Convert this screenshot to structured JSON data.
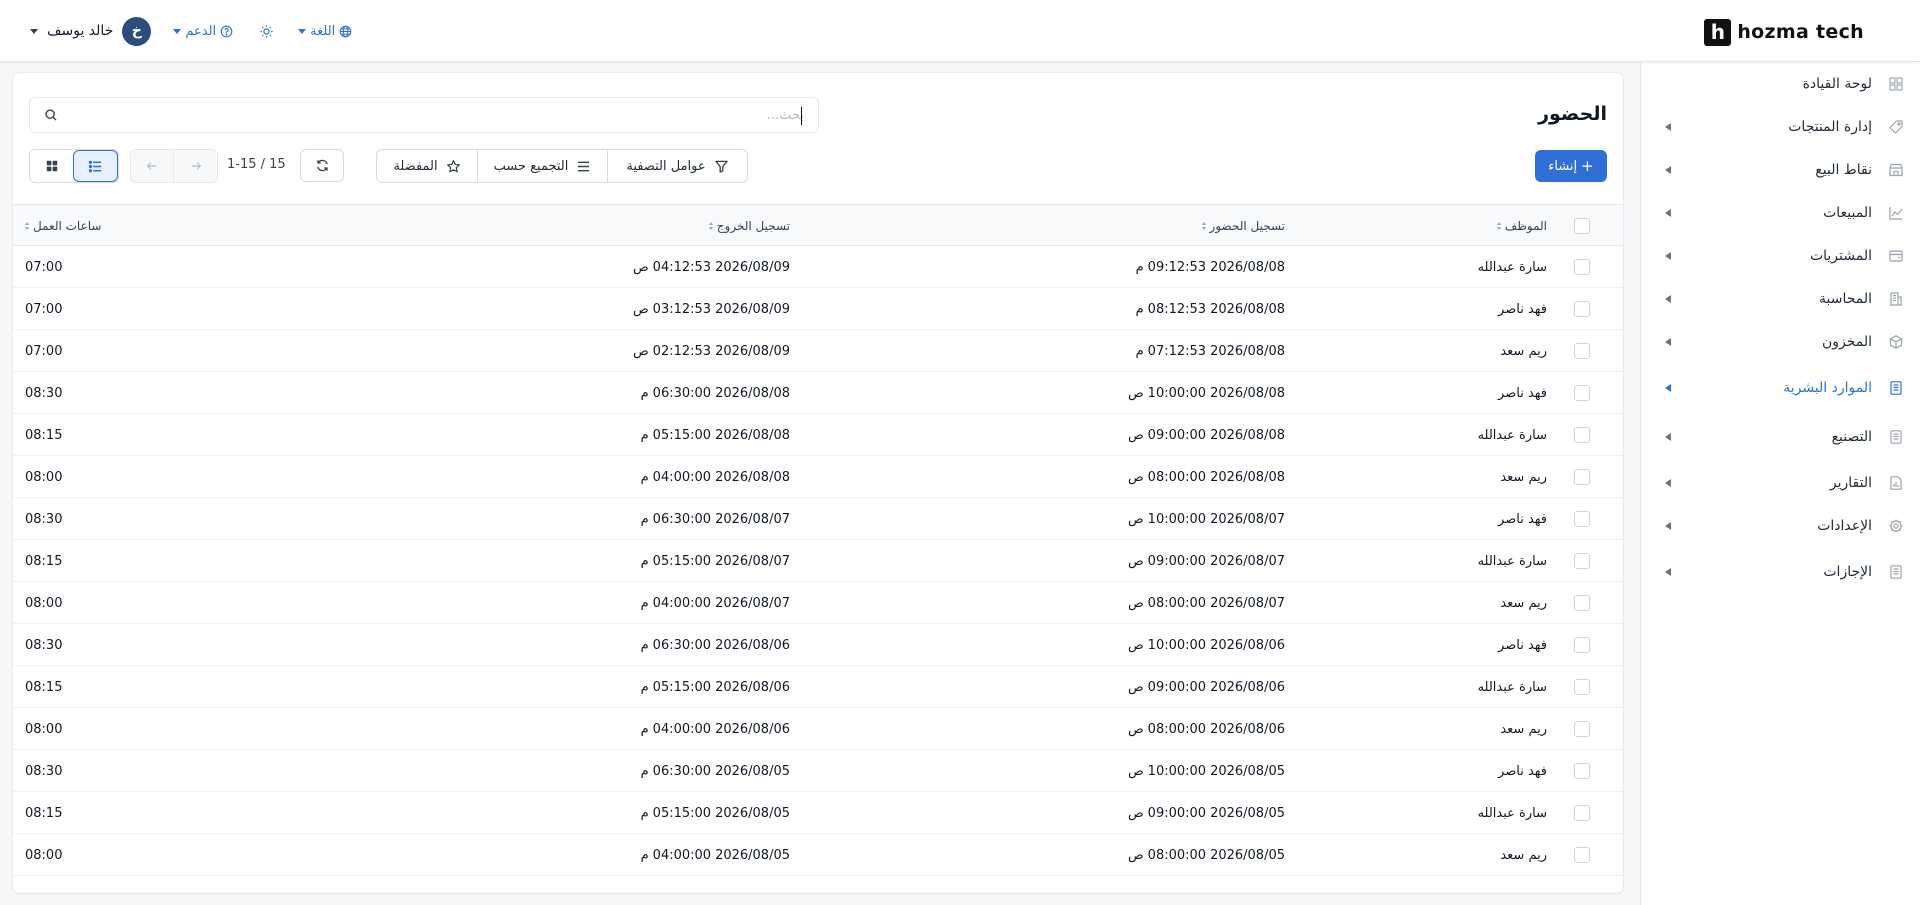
{
  "brand": {
    "logo_letter": "h",
    "name": "hozma tech"
  },
  "topbar": {
    "user_name": "خالد يوسف",
    "user_initial": "خ",
    "support_label": "الدعم",
    "language_label": "اللغة"
  },
  "sidebar": {
    "items": [
      {
        "label": "لوحة القيادة",
        "icon": "dashboard-icon",
        "has_arrow": false
      },
      {
        "label": "إدارة المنتجات",
        "icon": "tag-icon",
        "has_arrow": true
      },
      {
        "label": "نقاط البيع",
        "icon": "store-icon",
        "has_arrow": true
      },
      {
        "label": "المبيعات",
        "icon": "chart-line-icon",
        "has_arrow": true
      },
      {
        "label": "المشتريات",
        "icon": "wallet-icon",
        "has_arrow": true
      },
      {
        "label": "المحاسبة",
        "icon": "building-icon",
        "has_arrow": true
      },
      {
        "label": "المخزون",
        "icon": "box-icon",
        "has_arrow": true
      },
      {
        "label": "الموارد البشرية",
        "icon": "document-icon",
        "has_arrow": true,
        "active": true
      },
      {
        "label": "التصنيع",
        "icon": "document-icon",
        "has_arrow": true
      },
      {
        "label": "التقارير",
        "icon": "report-icon",
        "has_arrow": true
      },
      {
        "label": "الإعدادات",
        "icon": "gear-icon",
        "has_arrow": true
      },
      {
        "label": "الإجازات",
        "icon": "document-icon",
        "has_arrow": true
      }
    ]
  },
  "page": {
    "title": "الحضور",
    "search_placeholder": "بحث...",
    "create_label": "إنشاء",
    "filters_label": "عوامل التصفية",
    "group_by_label": "التجميع حسب",
    "favorites_label": "المفضلة",
    "pager_text": "1-15 / 15"
  },
  "table": {
    "columns": [
      "الموظف",
      "تسجيل الحضور",
      "تسجيل الخروج",
      "ساعات العمل"
    ],
    "rows": [
      {
        "employee": "سارة عبدالله",
        "check_in_date": "2026/08/08",
        "check_in_time": "09:12:53",
        "check_in_ampm": "م",
        "check_out_date": "2026/08/09",
        "check_out_time": "04:12:53",
        "check_out_ampm": "ص",
        "hours": "07:00"
      },
      {
        "employee": "فهد ناصر",
        "check_in_date": "2026/08/08",
        "check_in_time": "08:12:53",
        "check_in_ampm": "م",
        "check_out_date": "2026/08/09",
        "check_out_time": "03:12:53",
        "check_out_ampm": "ص",
        "hours": "07:00"
      },
      {
        "employee": "ريم سعد",
        "check_in_date": "2026/08/08",
        "check_in_time": "07:12:53",
        "check_in_ampm": "م",
        "check_out_date": "2026/08/09",
        "check_out_time": "02:12:53",
        "check_out_ampm": "ص",
        "hours": "07:00"
      },
      {
        "employee": "فهد ناصر",
        "check_in_date": "2026/08/08",
        "check_in_time": "10:00:00",
        "check_in_ampm": "ص",
        "check_out_date": "2026/08/08",
        "check_out_time": "06:30:00",
        "check_out_ampm": "م",
        "hours": "08:30"
      },
      {
        "employee": "سارة عبدالله",
        "check_in_date": "2026/08/08",
        "check_in_time": "09:00:00",
        "check_in_ampm": "ص",
        "check_out_date": "2026/08/08",
        "check_out_time": "05:15:00",
        "check_out_ampm": "م",
        "hours": "08:15"
      },
      {
        "employee": "ريم سعد",
        "check_in_date": "2026/08/08",
        "check_in_time": "08:00:00",
        "check_in_ampm": "ص",
        "check_out_date": "2026/08/08",
        "check_out_time": "04:00:00",
        "check_out_ampm": "م",
        "hours": "08:00"
      },
      {
        "employee": "فهد ناصر",
        "check_in_date": "2026/08/07",
        "check_in_time": "10:00:00",
        "check_in_ampm": "ص",
        "check_out_date": "2026/08/07",
        "check_out_time": "06:30:00",
        "check_out_ampm": "م",
        "hours": "08:30"
      },
      {
        "employee": "سارة عبدالله",
        "check_in_date": "2026/08/07",
        "check_in_time": "09:00:00",
        "check_in_ampm": "ص",
        "check_out_date": "2026/08/07",
        "check_out_time": "05:15:00",
        "check_out_ampm": "م",
        "hours": "08:15"
      },
      {
        "employee": "ريم سعد",
        "check_in_date": "2026/08/07",
        "check_in_time": "08:00:00",
        "check_in_ampm": "ص",
        "check_out_date": "2026/08/07",
        "check_out_time": "04:00:00",
        "check_out_ampm": "م",
        "hours": "08:00"
      },
      {
        "employee": "فهد ناصر",
        "check_in_date": "2026/08/06",
        "check_in_time": "10:00:00",
        "check_in_ampm": "ص",
        "check_out_date": "2026/08/06",
        "check_out_time": "06:30:00",
        "check_out_ampm": "م",
        "hours": "08:30"
      },
      {
        "employee": "سارة عبدالله",
        "check_in_date": "2026/08/06",
        "check_in_time": "09:00:00",
        "check_in_ampm": "ص",
        "check_out_date": "2026/08/06",
        "check_out_time": "05:15:00",
        "check_out_ampm": "م",
        "hours": "08:15"
      },
      {
        "employee": "ريم سعد",
        "check_in_date": "2026/08/06",
        "check_in_time": "08:00:00",
        "check_in_ampm": "ص",
        "check_out_date": "2026/08/06",
        "check_out_time": "04:00:00",
        "check_out_ampm": "م",
        "hours": "08:00"
      },
      {
        "employee": "فهد ناصر",
        "check_in_date": "2026/08/05",
        "check_in_time": "10:00:00",
        "check_in_ampm": "ص",
        "check_out_date": "2026/08/05",
        "check_out_time": "06:30:00",
        "check_out_ampm": "م",
        "hours": "08:30"
      },
      {
        "employee": "سارة عبدالله",
        "check_in_date": "2026/08/05",
        "check_in_time": "09:00:00",
        "check_in_ampm": "ص",
        "check_out_date": "2026/08/05",
        "check_out_time": "05:15:00",
        "check_out_ampm": "م",
        "hours": "08:15"
      },
      {
        "employee": "ريم سعد",
        "check_in_date": "2026/08/05",
        "check_in_time": "08:00:00",
        "check_in_ampm": "ص",
        "check_out_date": "2026/08/05",
        "check_out_time": "04:00:00",
        "check_out_ampm": "م",
        "hours": "08:00"
      }
    ]
  },
  "colors": {
    "accent": "#2f6fd6",
    "avatar": "#2c4e7e",
    "text": "#111827"
  }
}
